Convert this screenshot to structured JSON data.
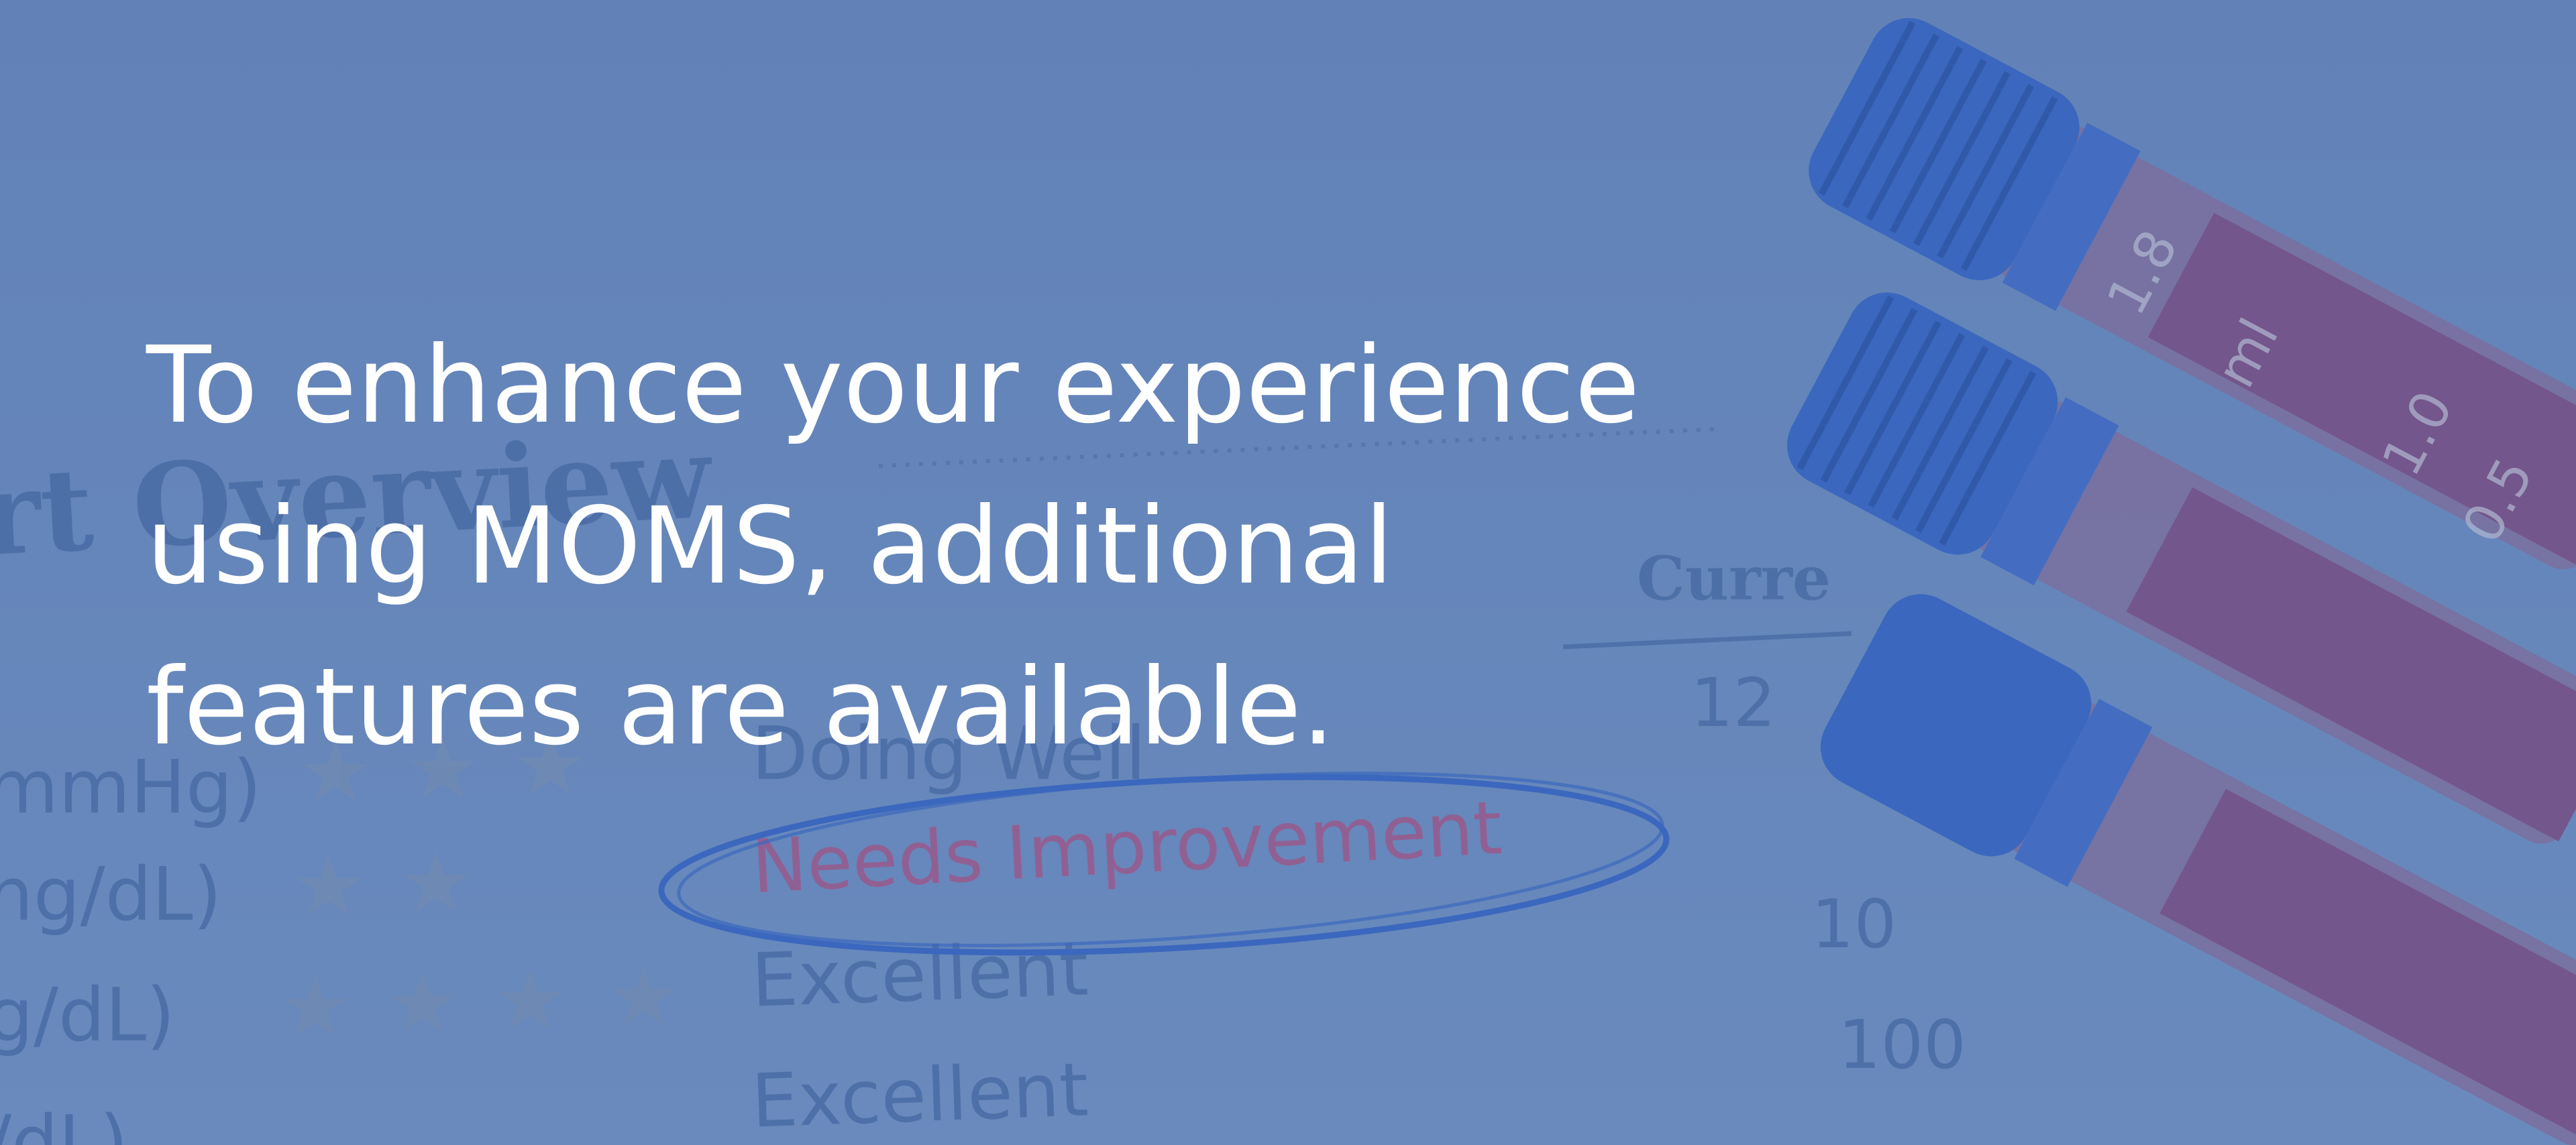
{
  "headline": {
    "line1": "To enhance your experience",
    "line2": "using MOMS, additional",
    "line3": "features are available."
  },
  "photo": {
    "report_title_fragment": "rt Overview",
    "column_header_fragment": "Curre",
    "status_doing_well": "Doing Well",
    "status_needs_improvement": "Needs Improvement",
    "status_excellent_1": "Excellent",
    "status_excellent_2": "Excellent",
    "unit_mmhg": "mmHg)",
    "unit_mgdl_1": "ng/dL)",
    "unit_mgdl_2": "g/dL)",
    "unit_mgdl_3": "/dL)",
    "value_120": "12",
    "value_100a": "10",
    "value_100b": "100",
    "tube_label_ml": "ml",
    "tube_mark_18": "1.8",
    "tube_mark_10": "1.0",
    "tube_mark_05": "0.5"
  },
  "colors": {
    "overlay": "#587eba",
    "text": "#ffffff",
    "cap_blue": "#2f5fc0",
    "needs_improvement_pink": "#b44a7a"
  }
}
